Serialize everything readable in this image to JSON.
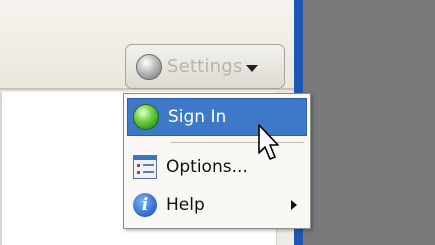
{
  "toolbar": {
    "settings_label": "Settings",
    "settings_icon": "gray-orb-icon",
    "dropdown_icon": "caret-down-icon"
  },
  "menu": {
    "items": [
      {
        "label": "Sign In",
        "icon": "green-orb-icon",
        "highlighted": true
      },
      {
        "label": "Options...",
        "icon": "options-list-icon"
      },
      {
        "label": "Help",
        "icon": "info-icon",
        "has_submenu": true
      }
    ]
  },
  "help_icon_glyph": "i",
  "colors": {
    "highlight": "#3d78c9",
    "gray_area": "#77797b",
    "blue_edge": "#1f57b5"
  }
}
